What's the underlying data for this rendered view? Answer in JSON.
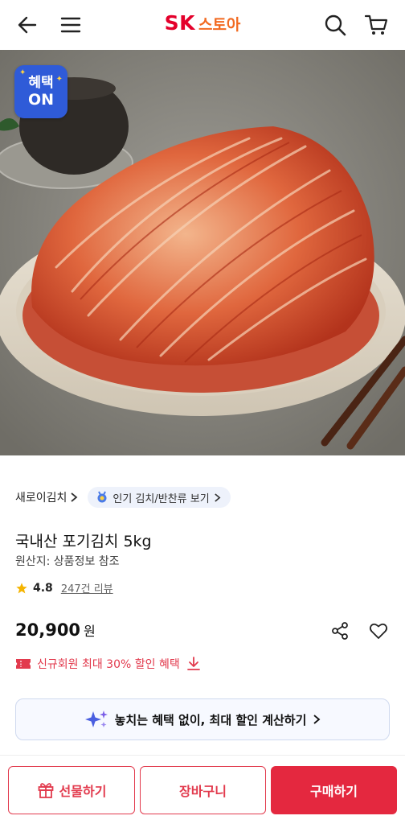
{
  "header": {
    "back_icon": "arrow-left-icon",
    "menu_icon": "hamburger-menu-icon",
    "logo_brand": "SK",
    "logo_store": "스토아",
    "search_icon": "search-icon",
    "cart_icon": "cart-icon",
    "brand_color": "#e4002b"
  },
  "image": {
    "badge_line1": "혜택",
    "badge_line2": "ON",
    "badge_color": "#2f5bd8"
  },
  "product": {
    "category": "새로이김치",
    "popular_link": "인기 김치/반찬류 보기",
    "title": "국내산 포기김치 5kg",
    "origin": "원산지: 상품정보 참조",
    "rating": "4.8",
    "review_count": "247건 리뷰",
    "price": "20,900",
    "currency": "원",
    "coupon_text": "신규회원 최대 30% 할인 혜택",
    "calc_banner": "놓치는 혜택 없이, 최대 할인 계산하기"
  },
  "bottom": {
    "gift_label": "선물하기",
    "cart_label": "장바구니",
    "buy_label": "구매하기",
    "accent_color": "#e4283f"
  }
}
